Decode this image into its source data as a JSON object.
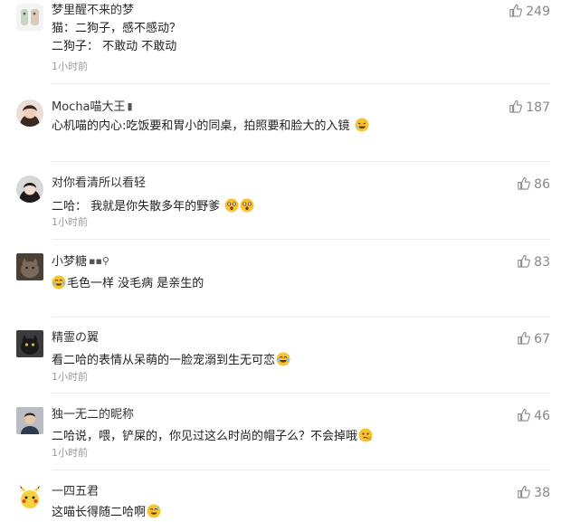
{
  "comments": [
    {
      "username": "梦里醒不来的梦",
      "lines": [
        "猫：二狗子，感不感动？",
        "二狗子： 不敢动 不敢动"
      ],
      "time": "1小时前",
      "likes": "249"
    },
    {
      "username": "Mocha喵大王",
      "lines": [
        "心机喵的内心:吃饭要和胃小的同桌，拍照要和脸大的入镜"
      ],
      "time": "",
      "likes": "187"
    },
    {
      "username": "对你看清所以看轻",
      "lines": [
        "二哈： 我就是你失散多年的野爹"
      ],
      "time": "1小时前",
      "likes": "86"
    },
    {
      "username": "小梦糖",
      "lines": [
        "毛色一样 没毛病 是亲生的"
      ],
      "time": "",
      "likes": "83"
    },
    {
      "username": "精霊の翼",
      "lines": [
        "看二哈的表情从呆萌的一脸宠溺到生无可恋"
      ],
      "time": "1小时前",
      "likes": "67"
    },
    {
      "username": "独一无二的昵称",
      "lines": [
        "二哈说，喂，铲屎的，你见过这么时尚的帽子么？不会掉哦"
      ],
      "time": "1小时前",
      "likes": "46"
    },
    {
      "username": "一四五君",
      "lines": [
        "这喵长得随二哈啊"
      ],
      "time": "",
      "likes": "38"
    }
  ],
  "colors": {
    "text": "#222222",
    "muted": "#9b9b9b",
    "like": "#888888",
    "emoji": "#f7c331"
  },
  "icons": {
    "like": "thumbs-up-icon",
    "emoji": "emoji-icon"
  }
}
